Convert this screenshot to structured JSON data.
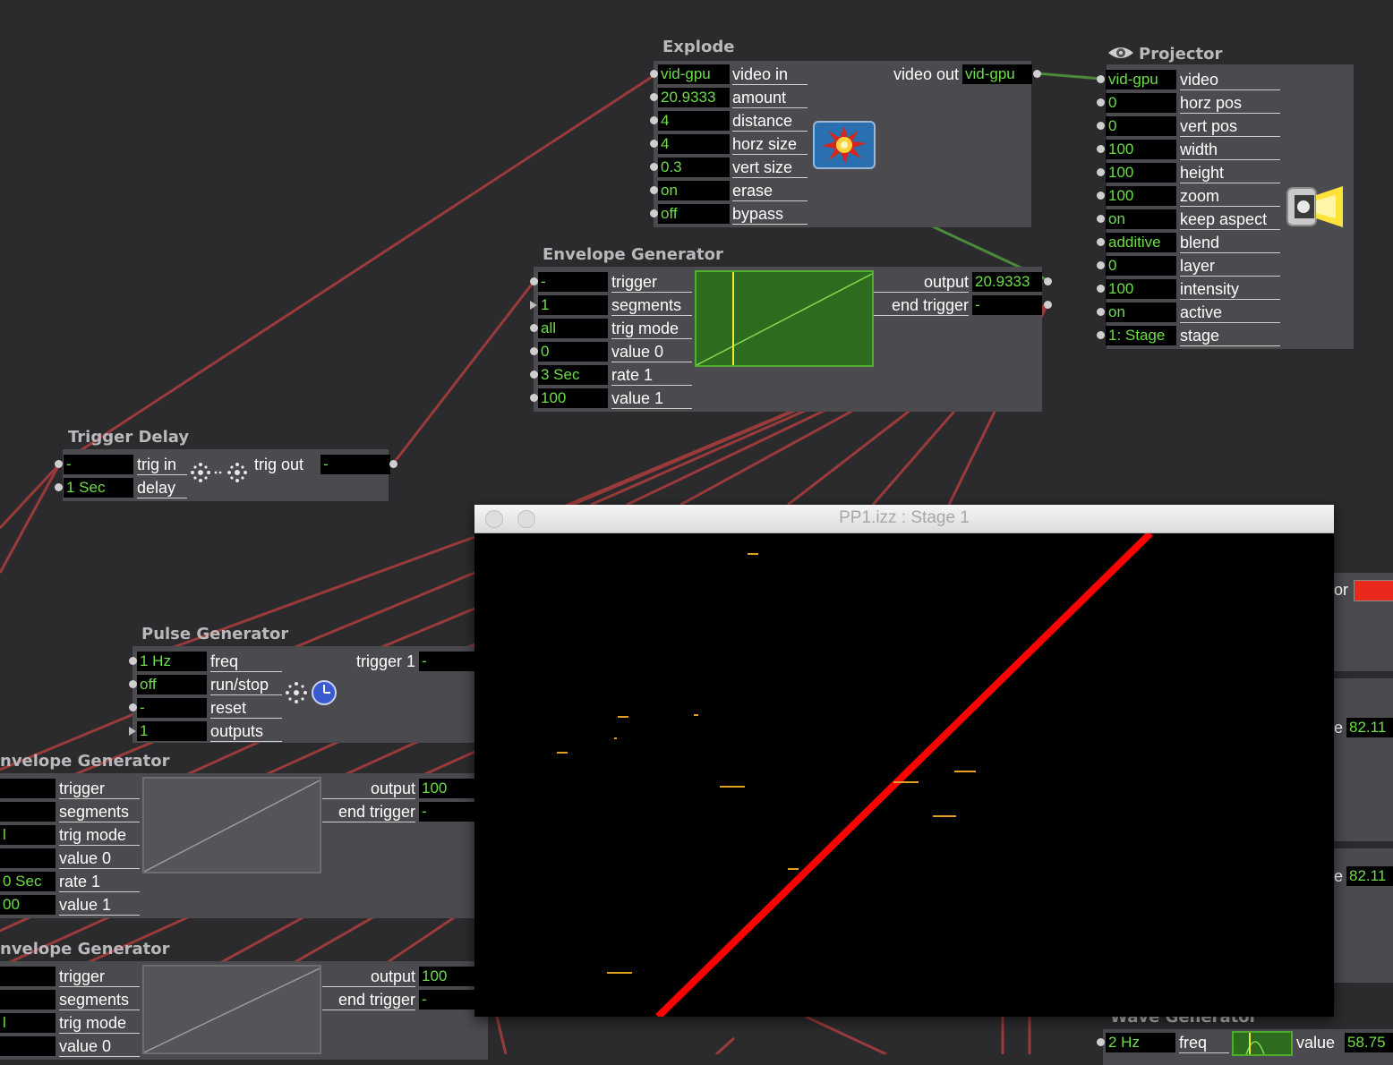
{
  "explode": {
    "title": "Explode",
    "inputs": [
      {
        "value": "vid-gpu",
        "label": "video in"
      },
      {
        "value": "20.9333",
        "label": "amount"
      },
      {
        "value": "4",
        "label": "distance"
      },
      {
        "value": "4",
        "label": "horz size"
      },
      {
        "value": "0.3",
        "label": "vert size"
      },
      {
        "value": "on",
        "label": "erase"
      },
      {
        "value": "off",
        "label": "bypass"
      }
    ],
    "output": {
      "label": "video out",
      "value": "vid-gpu"
    },
    "icon": "explosion-icon"
  },
  "projector": {
    "title": "Projector",
    "title_icon": "eye-icon",
    "icon": "projector-light-icon",
    "inputs": [
      {
        "value": "vid-gpu",
        "label": "video"
      },
      {
        "value": "0",
        "label": "horz pos"
      },
      {
        "value": "0",
        "label": "vert pos"
      },
      {
        "value": "100",
        "label": "width"
      },
      {
        "value": "100",
        "label": "height"
      },
      {
        "value": "100",
        "label": "zoom"
      },
      {
        "value": "on",
        "label": "keep aspect"
      },
      {
        "value": "additive",
        "label": "blend"
      },
      {
        "value": "0",
        "label": "layer"
      },
      {
        "value": "100",
        "label": "intensity"
      },
      {
        "value": "on",
        "label": "active"
      },
      {
        "value": "1: Stage",
        "label": "stage"
      }
    ]
  },
  "envelope_main": {
    "title": "Envelope Generator",
    "inputs": [
      {
        "value": "-",
        "label": "trigger"
      },
      {
        "value": "1",
        "label": "segments"
      },
      {
        "value": "all",
        "label": "trig mode"
      },
      {
        "value": "0",
        "label": "value 0"
      },
      {
        "value": "3 Sec",
        "label": "rate 1"
      },
      {
        "value": "100",
        "label": "value 1"
      }
    ],
    "outputs": [
      {
        "label": "output",
        "value": "20.9333"
      },
      {
        "label": "end trigger",
        "value": "-"
      }
    ]
  },
  "trigger_delay": {
    "title": "Trigger Delay",
    "inputs": [
      {
        "value": "-",
        "label": "trig in"
      },
      {
        "value": "1 Sec",
        "label": "delay"
      }
    ],
    "output": {
      "label": "trig out",
      "value": "-"
    },
    "icon": "sparkle-delay-icon"
  },
  "pulse_generator": {
    "title": "Pulse Generator",
    "inputs": [
      {
        "value": "1 Hz",
        "label": "freq"
      },
      {
        "value": "off",
        "label": "run/stop"
      },
      {
        "value": "-",
        "label": "reset"
      },
      {
        "value": "1",
        "label": "outputs"
      }
    ],
    "output": {
      "label": "trigger 1",
      "value": "-"
    }
  },
  "envelope_2": {
    "title": "nvelope Generator",
    "inputs": [
      {
        "value": "",
        "label": "trigger"
      },
      {
        "value": "",
        "label": "segments"
      },
      {
        "value": "l",
        "label": "trig mode"
      },
      {
        "value": "",
        "label": "value 0"
      },
      {
        "value": "0 Sec",
        "label": "rate 1"
      },
      {
        "value": "00",
        "label": "value 1"
      }
    ],
    "outputs": [
      {
        "label": "output",
        "value": "100"
      },
      {
        "label": "end trigger",
        "value": "-"
      }
    ]
  },
  "envelope_3": {
    "title": "nvelope Generator",
    "inputs": [
      {
        "value": "",
        "label": "trigger"
      },
      {
        "value": "",
        "label": "segments"
      },
      {
        "value": "l",
        "label": "trig mode"
      },
      {
        "value": "",
        "label": "value 0"
      }
    ],
    "outputs": [
      {
        "label": "output",
        "value": "100"
      },
      {
        "label": "end trigger",
        "value": "-"
      }
    ]
  },
  "right_partial": {
    "color_label": "or",
    "value_a_label": "e",
    "value_a": "82.11",
    "value_b_label": "e",
    "value_b": "82.11"
  },
  "wave_generator": {
    "title": "Wave Generator",
    "freq_value": "2 Hz",
    "freq_label": "freq",
    "value_label": "value",
    "value": "58.75"
  },
  "stage_window": {
    "title": "PP1.izz : Stage 1"
  },
  "colors": {
    "background": "#2b2b2d",
    "actor_body": "#4a4a4f",
    "value_text": "#6fdc4a",
    "control_wire": "#9a3a3a",
    "video_wire": "#4a8a3a",
    "stage_line": "#ff0000"
  }
}
